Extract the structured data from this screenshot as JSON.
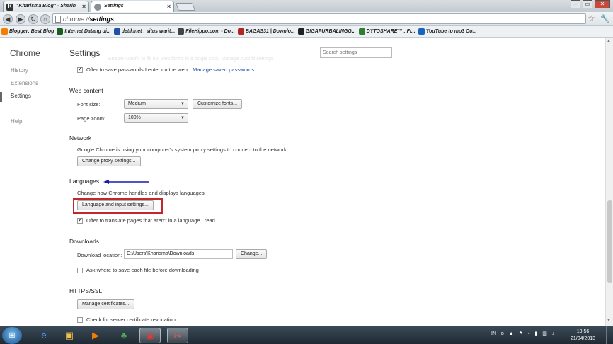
{
  "browser": {
    "tabs": [
      {
        "title": "\"Kharisma Blog\" - Sharin",
        "favicon_letter": "K"
      },
      {
        "title": "Settings"
      }
    ],
    "window_controls": [
      "–",
      "▭",
      "✕"
    ],
    "address": {
      "prefix": "chrome://",
      "bold": "settings"
    },
    "bookmarks": [
      {
        "label": "Blogger: Best Blog",
        "color": "#f57d00"
      },
      {
        "label": "Internet Datang di...",
        "color": "#1b5e20"
      },
      {
        "label": "detikinet : situs warit...",
        "color": "#1f4fa8"
      },
      {
        "label": "FileHippo.com - Do...",
        "color": "#444444"
      },
      {
        "label": "BAGAS31 | Downlo...",
        "color": "#b0281f"
      },
      {
        "label": "GIGAPURBALINGG...",
        "color": "#222222"
      },
      {
        "label": "DYTOSHARE™ : Fi...",
        "color": "#2e7d32"
      },
      {
        "label": "YouTube to mp3 Co...",
        "color": "#1565c0"
      }
    ]
  },
  "sidebar": {
    "brand": "Chrome",
    "items": [
      "History",
      "Extensions",
      "Settings",
      "Help"
    ]
  },
  "main": {
    "title": "Settings",
    "search_placeholder": "Search settings",
    "ghost_text": "Enable Autofill to fill out web forms in a single click. Manage Autofill settings",
    "passwords": {
      "label": "Offer to save passwords I enter on the web.",
      "link": "Manage saved passwords"
    },
    "web_content": {
      "heading": "Web content",
      "font_size_label": "Font size:",
      "font_size_value": "Medium",
      "customize_fonts": "Customize fonts...",
      "page_zoom_label": "Page zoom:",
      "page_zoom_value": "100%"
    },
    "network": {
      "heading": "Network",
      "description": "Google Chrome is using your computer's system proxy settings to connect to the network.",
      "button": "Change proxy settings..."
    },
    "languages": {
      "heading": "Languages",
      "description": "Change how Chrome handles and displays languages",
      "button": "Language and input settings...",
      "translate_label": "Offer to translate pages that aren't in a language I read"
    },
    "downloads": {
      "heading": "Downloads",
      "location_label": "Download location:",
      "location_value": "C:\\Users\\Kharisma\\Downloads",
      "change_button": "Change...",
      "ask_label": "Ask where to save each file before downloading"
    },
    "https": {
      "heading": "HTTPS/SSL",
      "manage_button": "Manage certificates...",
      "revocation_label": "Check for server certificate revocation"
    }
  },
  "annotation": {
    "arrow_color": "#1a1aa8",
    "box_color": "#c0282e"
  },
  "taskbar": {
    "input_lang": "IN",
    "time": "19:56",
    "date": "21/04/2013"
  }
}
